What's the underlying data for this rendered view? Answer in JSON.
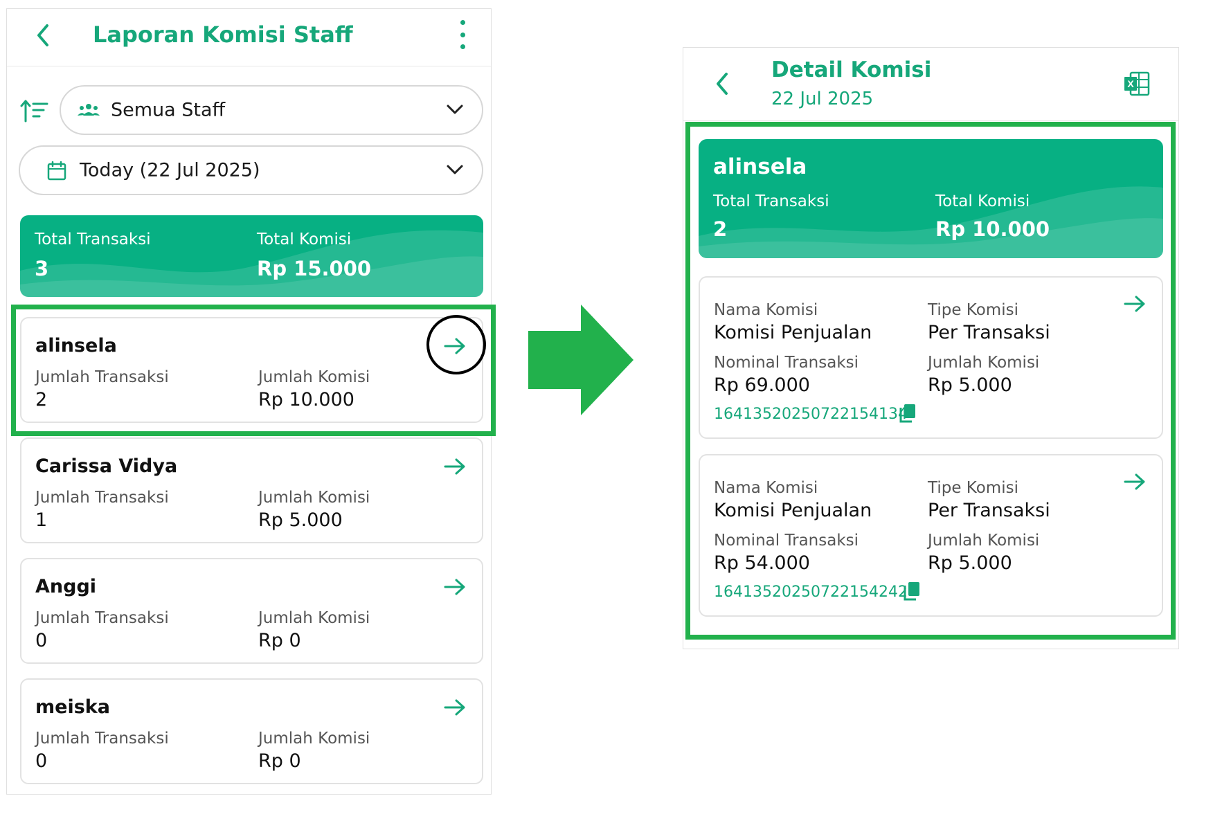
{
  "left": {
    "header": {
      "title": "Laporan Komisi Staff"
    },
    "staff_filter": {
      "value": "Semua Staff"
    },
    "date_filter": {
      "value": "Today (22 Jul 2025)"
    },
    "summary": {
      "total_transaksi_label": "Total Transaksi",
      "total_transaksi_value": "3",
      "total_komisi_label": "Total Komisi",
      "total_komisi_value": "Rp 15.000"
    },
    "staff": [
      {
        "name": "alinsela",
        "trx_label": "Jumlah Transaksi",
        "trx_value": "2",
        "kom_label": "Jumlah Komisi",
        "kom_value": "Rp 10.000"
      },
      {
        "name": "Carissa Vidya",
        "trx_label": "Jumlah Transaksi",
        "trx_value": "1",
        "kom_label": "Jumlah Komisi",
        "kom_value": "Rp 5.000"
      },
      {
        "name": "Anggi",
        "trx_label": "Jumlah Transaksi",
        "trx_value": "0",
        "kom_label": "Jumlah Komisi",
        "kom_value": "Rp 0"
      },
      {
        "name": "meiska",
        "trx_label": "Jumlah Transaksi",
        "trx_value": "0",
        "kom_label": "Jumlah Komisi",
        "kom_value": "Rp 0"
      }
    ]
  },
  "right": {
    "header": {
      "title": "Detail Komisi",
      "date": "22 Jul 2025"
    },
    "summary": {
      "name": "alinsela",
      "total_transaksi_label": "Total Transaksi",
      "total_transaksi_value": "2",
      "total_komisi_label": "Total Komisi",
      "total_komisi_value": "Rp 10.000"
    },
    "details": [
      {
        "nama_label": "Nama Komisi",
        "nama_value": "Komisi Penjualan",
        "tipe_label": "Tipe Komisi",
        "tipe_value": "Per Transaksi",
        "nominal_label": "Nominal Transaksi",
        "nominal_value": "Rp 69.000",
        "jumlah_label": "Jumlah Komisi",
        "jumlah_value": "Rp 5.000",
        "id": "16413520250722154134"
      },
      {
        "nama_label": "Nama Komisi",
        "nama_value": "Komisi Penjualan",
        "tipe_label": "Tipe Komisi",
        "tipe_value": "Per Transaksi",
        "nominal_label": "Nominal Transaksi",
        "nominal_value": "Rp 54.000",
        "jumlah_label": "Jumlah Komisi",
        "jumlah_value": "Rp 5.000",
        "id": "16413520250722154242"
      }
    ]
  },
  "colors": {
    "accent": "#16a77a",
    "summary_bg": "#07b083",
    "highlight": "#22b14c"
  }
}
